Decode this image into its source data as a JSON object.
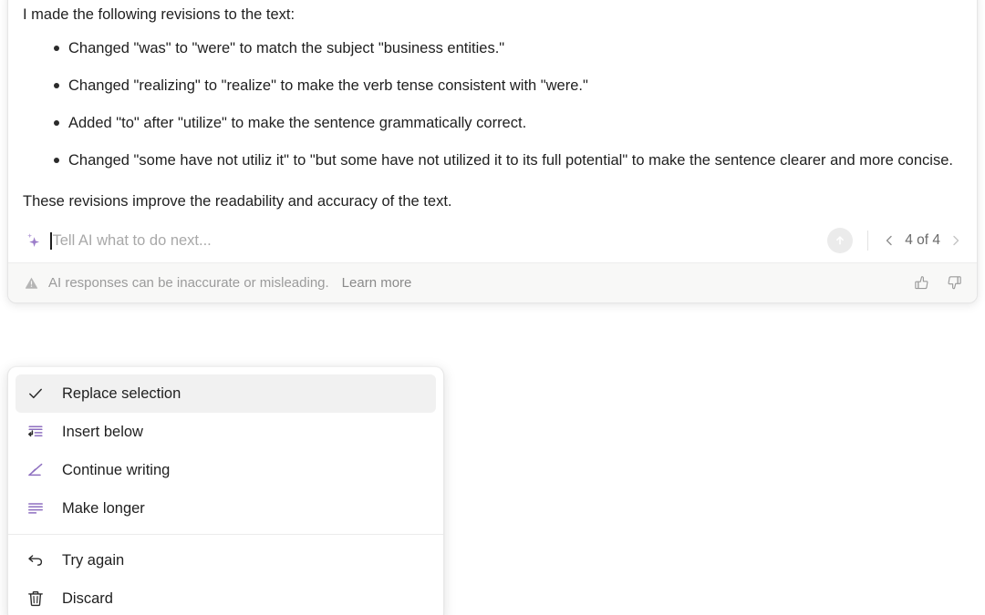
{
  "response": {
    "intro": "I made the following revisions to the text:",
    "bullets": [
      "Changed \"was\" to \"were\" to match the subject \"business entities.\"",
      "Changed \"realizing\" to \"realize\" to make the verb tense consistent with \"were.\"",
      "Added \"to\" after \"utilize\" to make the sentence grammatically correct.",
      "Changed \"some have not utiliz it\" to \"but some have not utilized it to its full potential\" to make the sentence clearer and more concise."
    ],
    "closing": "These revisions improve the readability and accuracy of the text."
  },
  "prompt": {
    "placeholder": "Tell AI what to do next...",
    "value": "",
    "sparkle_icon": "sparkle-icon",
    "send_icon": "arrow-up-circle-icon"
  },
  "pager": {
    "prev_icon": "chevron-left-icon",
    "next_icon": "chevron-right-icon",
    "label": "4 of 4",
    "current": 4,
    "total": 4
  },
  "disclaimer": {
    "warning_icon": "warning-triangle-icon",
    "text": "AI responses can be inaccurate or misleading.",
    "learn_more": "Learn more",
    "thumbs_up_icon": "thumbs-up-icon",
    "thumbs_down_icon": "thumbs-down-icon"
  },
  "menu": {
    "items": [
      {
        "label": "Replace selection",
        "icon": "check-icon",
        "selected": true
      },
      {
        "label": "Insert below",
        "icon": "insert-below-icon",
        "selected": false
      },
      {
        "label": "Continue writing",
        "icon": "pencil-icon",
        "selected": false
      },
      {
        "label": "Make longer",
        "icon": "text-lines-icon",
        "selected": false
      }
    ],
    "secondary_items": [
      {
        "label": "Try again",
        "icon": "undo-arrow-icon"
      },
      {
        "label": "Discard",
        "icon": "trash-icon"
      }
    ]
  },
  "colors": {
    "accent_purple": "#8e6fc0",
    "text_primary": "#1f1f1f",
    "text_muted": "#9b9b9b",
    "selected_row": "#f1f1f1",
    "footer_bg": "#f8f8f7"
  }
}
